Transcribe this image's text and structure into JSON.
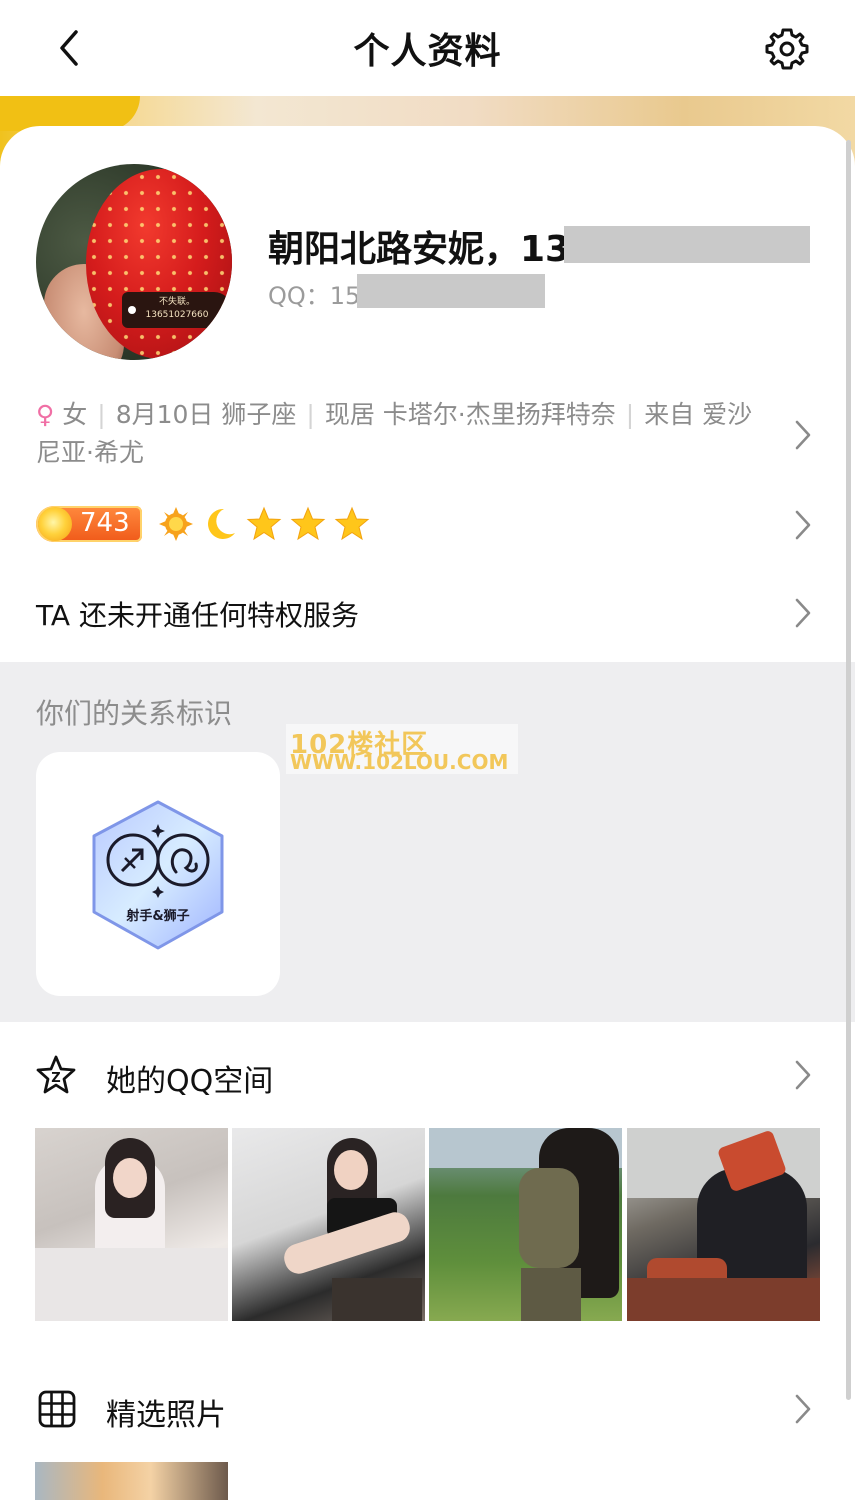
{
  "nav": {
    "title": "个人资料",
    "back_icon": "chevron-left-icon",
    "settings_icon": "gear-icon"
  },
  "profile": {
    "name": "朝阳北路安妮，13",
    "qq_label": "QQ：15",
    "avatar_tag_line1": "不失联。",
    "avatar_tag_line2": "13651027660"
  },
  "info": {
    "gender_symbol": "♀",
    "gender": "女",
    "birthday": "8月10日",
    "zodiac": "狮子座",
    "residence": "现居 卡塔尔·杰里扬拜特奈",
    "hometown": "来自 爱沙尼亚·希尤"
  },
  "level": {
    "value": "743",
    "icons": [
      "sun-icon",
      "moon-icon",
      "star-icon",
      "star-icon",
      "star-icon"
    ]
  },
  "privilege": {
    "text": "TA 还未开通任何特权服务"
  },
  "relation": {
    "label": "你们的关系标识",
    "badge_text": "射手&狮子"
  },
  "watermark": {
    "line1": "102楼社区",
    "line2": "WWW.102LOU.COM"
  },
  "qzone": {
    "title": "她的QQ空间",
    "photo_count": 4
  },
  "featured": {
    "title": "精选照片"
  },
  "colors": {
    "female": "#f06fa5",
    "level_orange": "#f05a1a",
    "star_yellow": "#ffc61a",
    "section_bg": "#eeeef0"
  }
}
